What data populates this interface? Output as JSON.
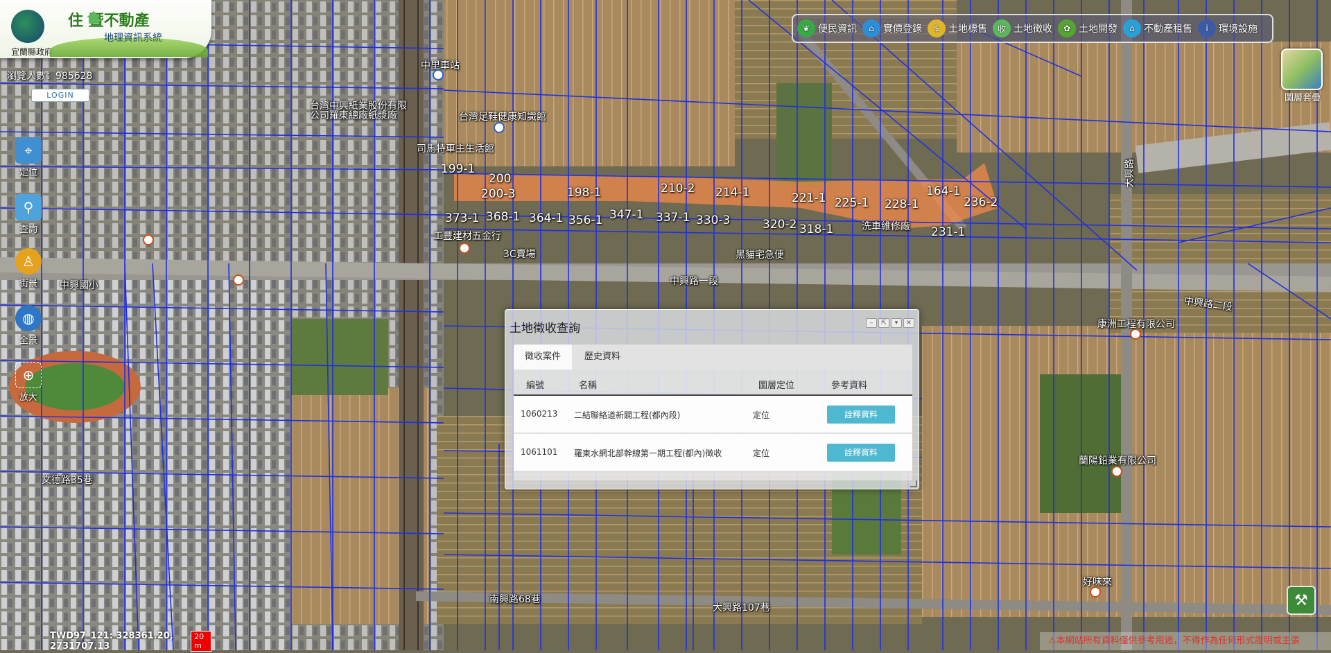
{
  "header": {
    "gov_name": "宜蘭縣政府",
    "title_main": "住  暨不動產",
    "title_sub": "地理資訊系統"
  },
  "topnav": [
    {
      "label": "便民資訊",
      "icon": "leaf-icon",
      "color": "#3aa845"
    },
    {
      "label": "實價登錄",
      "icon": "price-tag-icon",
      "color": "#2c8ed6"
    },
    {
      "label": "土地標售",
      "icon": "money-bag-icon",
      "color": "#e0b52a"
    },
    {
      "label": "土地徵收",
      "icon": "expropriation-icon",
      "color": "#5cb85c"
    },
    {
      "label": "土地開發",
      "icon": "sprout-icon",
      "color": "#55a532"
    },
    {
      "label": "不動產租售",
      "icon": "house-icon",
      "color": "#2aa0d8"
    },
    {
      "label": "環境設施",
      "icon": "info-icon",
      "color": "#3b5ba8"
    }
  ],
  "visitor": {
    "label": "瀏覽人數：",
    "count": "985628"
  },
  "login_label": "LOGIN",
  "tools": [
    {
      "label": "定位",
      "icon": "locate-icon"
    },
    {
      "label": "查詢",
      "icon": "search-icon"
    },
    {
      "label": "街景",
      "icon": "pegman-icon"
    },
    {
      "label": "全景",
      "icon": "globe-icon"
    },
    {
      "label": "放大",
      "icon": "zoom-in-icon"
    }
  ],
  "layer_label": "圖層套疊",
  "map": {
    "plots": [
      "199-1",
      "200",
      "200-3",
      "198-1",
      "210-2",
      "214-1",
      "221-1",
      "225-1",
      "228-1",
      "164-1",
      "236-2",
      "373-1",
      "368-1",
      "364-1",
      "356-1",
      "347-1",
      "337-1",
      "330-3",
      "320-2",
      "318-1",
      "231-1"
    ],
    "places": [
      "台灣中興紙業股份有限",
      "公司羅東總廠紙漿廠",
      "中里車站",
      "台灣足鞋健康知識館",
      "司馬特車主生活館",
      "工豐建材五金行",
      "3C賣場",
      "黑貓宅急便",
      "洗車維修廠",
      "中興國小",
      "康洲工程有限公司",
      "蘭陽鉛業有限公司",
      "好味來",
      "中興路一段",
      "中興路二段",
      "文德路35巷",
      "南興路68巷",
      "大興路107巷",
      "大興路"
    ]
  },
  "dialog": {
    "title": "土地徵收查詢",
    "tabs": [
      "徵收案件",
      "歷史資料"
    ],
    "columns": [
      "編號",
      "名稱",
      "圖層定位",
      "參考資料"
    ],
    "rows": [
      {
        "id": "1060213",
        "name": "二結聯絡道新闢工程(都內段)",
        "locate": "定位",
        "ref": "詮釋資料"
      },
      {
        "id": "1061101",
        "name": "羅東水網北部幹線第一期工程(都內)徵收",
        "locate": "定位",
        "ref": "詮釋資料"
      }
    ]
  },
  "status": {
    "coords": "TWD97_121: 328361.20, 2731707.13",
    "scale": "20 m",
    "disclaimer": "⚠本網站所有資料僅供參考用途，不得作為任何形式證明或主張"
  },
  "colors": {
    "parcel_line": "#2030e0",
    "highlight": "#f08a4b",
    "ref_button": "#4db8cf"
  }
}
